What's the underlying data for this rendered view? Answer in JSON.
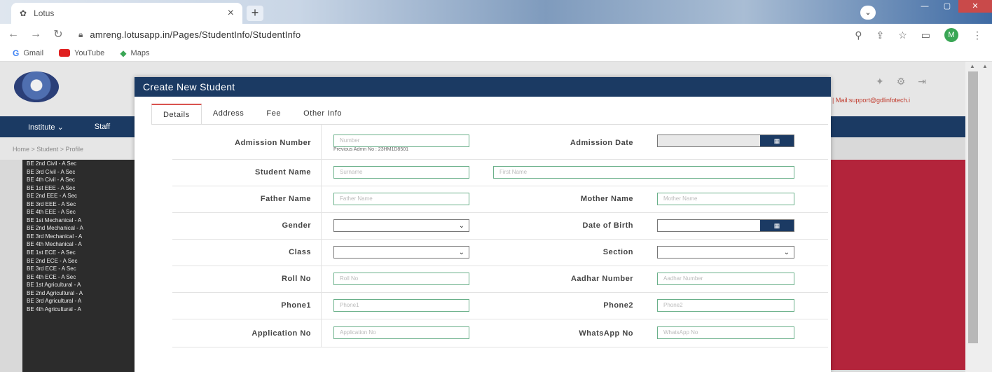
{
  "browser": {
    "tab_title": "Lotus",
    "tab_close": "×",
    "new_tab": "+",
    "url": "amreng.lotusapp.in/Pages/StudentInfo/StudentInfo",
    "avatar_letter": "M",
    "bookmarks": [
      {
        "label": "Gmail"
      },
      {
        "label": "YouTube"
      },
      {
        "label": "Maps"
      }
    ]
  },
  "page": {
    "nav_items": [
      "Institute ⌄",
      "Staff"
    ],
    "breadcrumb": "Home > Student > Profile",
    "header_note": "| Mail:support@gdlinfotech.i",
    "sidebar_classes": [
      "BE 2nd Civil - A Sec",
      "BE 3rd Civil - A Sec",
      "BE 4th Civil - A Sec",
      "BE 1st EEE - A Sec",
      "BE 2nd EEE - A Sec",
      "BE 3rd EEE - A Sec",
      "BE 4th EEE - A Sec",
      "BE 1st Mechanical - A",
      "BE 2nd Mechanical - A",
      "BE 3rd Mechanical - A",
      "BE 4th Mechanical - A",
      "BE 1st ECE - A Sec",
      "BE 2nd ECE - A Sec",
      "BE 3rd ECE - A Sec",
      "BE 4th ECE - A Sec",
      "BE 1st Agricultural - A",
      "BE 2nd Agricultural - A",
      "BE 3rd Agricultural - A",
      "BE 4th Agricultural - A"
    ]
  },
  "modal": {
    "title": "Create New Student",
    "tabs": [
      "Details",
      "Address",
      "Fee",
      "Other Info"
    ],
    "fields": {
      "admission_number": {
        "label": "Admission Number",
        "placeholder": "Number",
        "hint": "Previous Admn No : 23HM1D8501"
      },
      "admission_date": {
        "label": "Admission Date"
      },
      "student_name": {
        "label": "Student Name",
        "surname_placeholder": "Surname",
        "firstname_placeholder": "First Name"
      },
      "father_name": {
        "label": "Father Name",
        "placeholder": "Father Name"
      },
      "mother_name": {
        "label": "Mother Name",
        "placeholder": "Mother Name"
      },
      "gender": {
        "label": "Gender",
        "value": ""
      },
      "date_of_birth": {
        "label": "Date of Birth"
      },
      "class": {
        "label": "Class",
        "value": ""
      },
      "section": {
        "label": "Section",
        "value": ""
      },
      "roll_no": {
        "label": "Roll No",
        "placeholder": "Roll No"
      },
      "aadhar_number": {
        "label": "Aadhar Number",
        "placeholder": "Aadhar Number"
      },
      "phone1": {
        "label": "Phone1",
        "placeholder": "Phone1"
      },
      "phone2": {
        "label": "Phone2",
        "placeholder": "Phone2"
      },
      "application_no": {
        "label": "Application No",
        "placeholder": "Application No"
      },
      "whatsapp_no": {
        "label": "WhatsApp No",
        "placeholder": "WhatsApp No"
      }
    }
  },
  "colors": {
    "navy": "#1b3a63",
    "accent_red": "#b3243b",
    "input_border": "#6ab08a"
  },
  "icons": {
    "calendar": "calendar-icon",
    "chevron": "chevron-down-icon"
  }
}
